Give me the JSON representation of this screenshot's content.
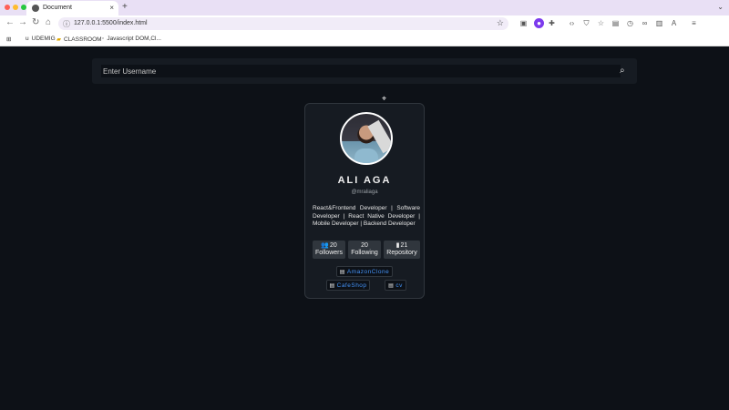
{
  "browser": {
    "tab_title": "Document",
    "tab_close": "×",
    "new_tab": "+",
    "url": "127.0.0.1:5500/index.html",
    "bookmarks": [
      {
        "label": "UDEMIG"
      },
      {
        "label": "CLASSROOM"
      },
      {
        "label": "Javascript DOM,Cl..."
      }
    ]
  },
  "search": {
    "placeholder": "Enter Username"
  },
  "profile": {
    "name": "ALI AGA",
    "username": "@mraliaga",
    "bio": "React&Frontend Developer | Software Developer | React Native Developer | Mobile Developer | Backend Developer",
    "stats": {
      "followers_count": "20",
      "followers_label": "Followers",
      "following_count": "20",
      "following_label": "Following",
      "repos_count": "21",
      "repos_label": "Repository"
    },
    "repos": [
      {
        "name": "AmazonClone"
      },
      {
        "name": "CafeShop"
      },
      {
        "name": "cv"
      }
    ]
  },
  "colors": {
    "page_bg": "#0d1117",
    "card_bg": "#161b22",
    "link": "#4493f8"
  }
}
